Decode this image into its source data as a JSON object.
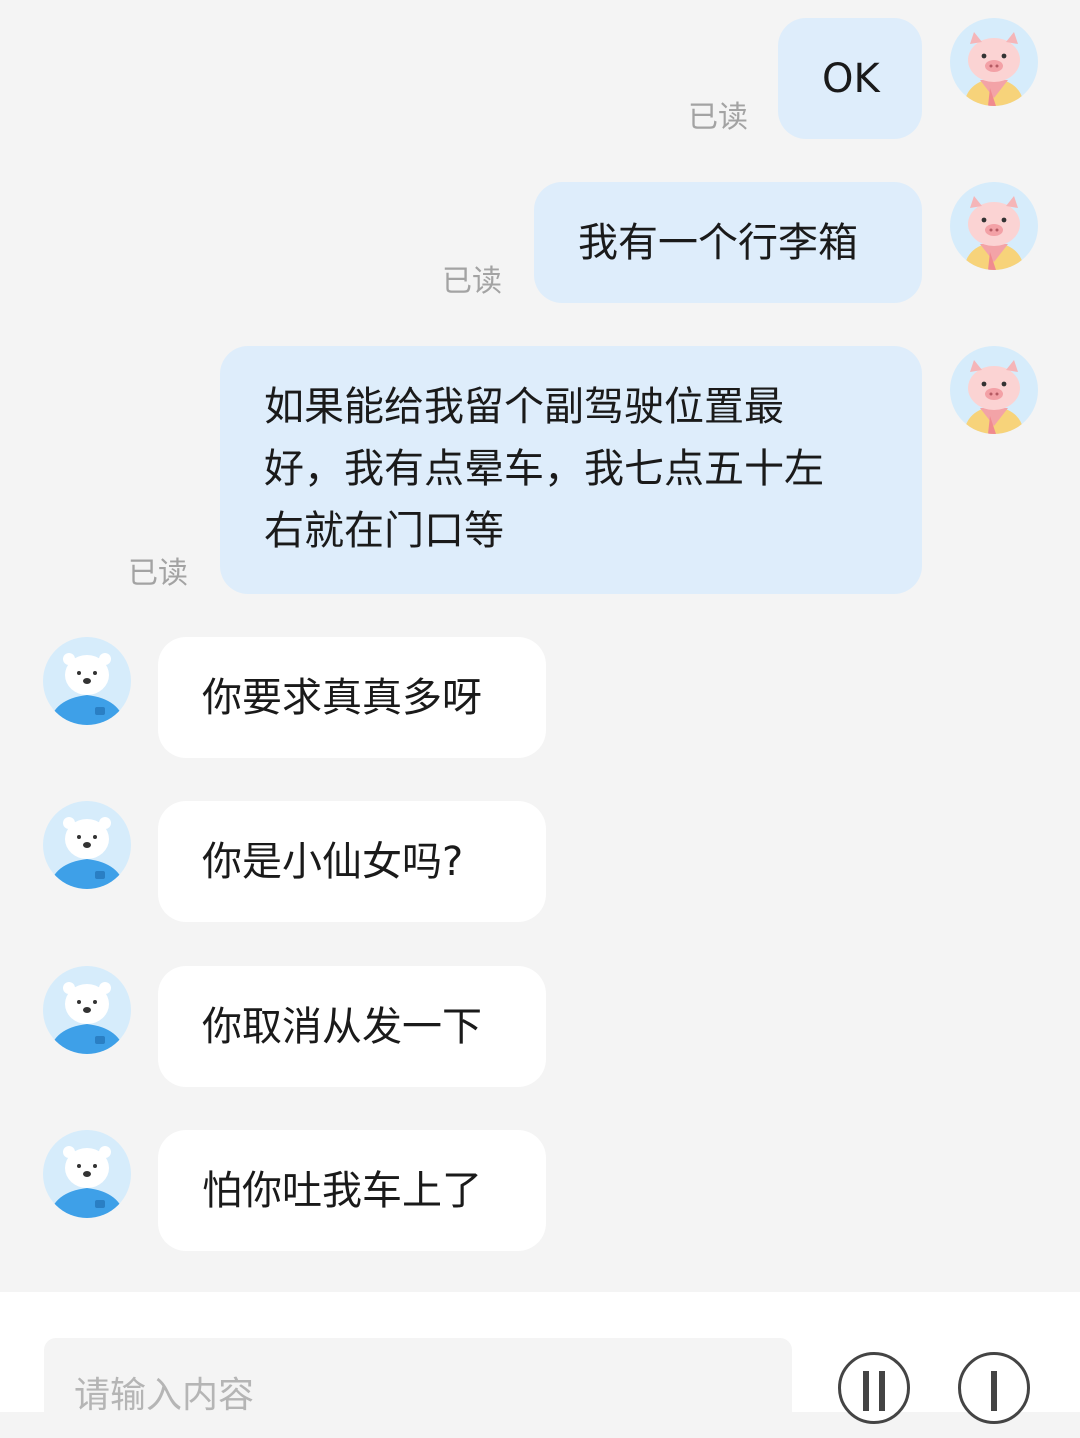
{
  "messages": [
    {
      "side": "out",
      "text": "OK",
      "read": "已读",
      "avatar": "pig-avatar-icon"
    },
    {
      "side": "out",
      "text": "我有一个行李箱",
      "read": "已读",
      "avatar": "pig-avatar-icon"
    },
    {
      "side": "out",
      "text_lines": [
        "如果能给我留个副驾驶位置最",
        "好，我有点晕车，我七点五十左",
        "右就在门口等"
      ],
      "read": "已读",
      "avatar": "pig-avatar-icon"
    },
    {
      "side": "in",
      "text": "你要求真真多呀",
      "avatar": "bear-avatar-icon"
    },
    {
      "side": "in",
      "text": "你是小仙女吗?",
      "avatar": "bear-avatar-icon"
    },
    {
      "side": "in",
      "text": "你取消从发一下",
      "avatar": "bear-avatar-icon"
    },
    {
      "side": "in",
      "text": "怕你吐我车上了",
      "avatar": "bear-avatar-icon"
    }
  ],
  "composer": {
    "placeholder": "请输入内容",
    "buttons": [
      "voice-icon",
      "more-icon"
    ]
  },
  "colors": {
    "background": "#f4f4f4",
    "outgoing_bubble": "#deedfb",
    "incoming_bubble": "#ffffff",
    "read_label": "#a3a3a3"
  }
}
